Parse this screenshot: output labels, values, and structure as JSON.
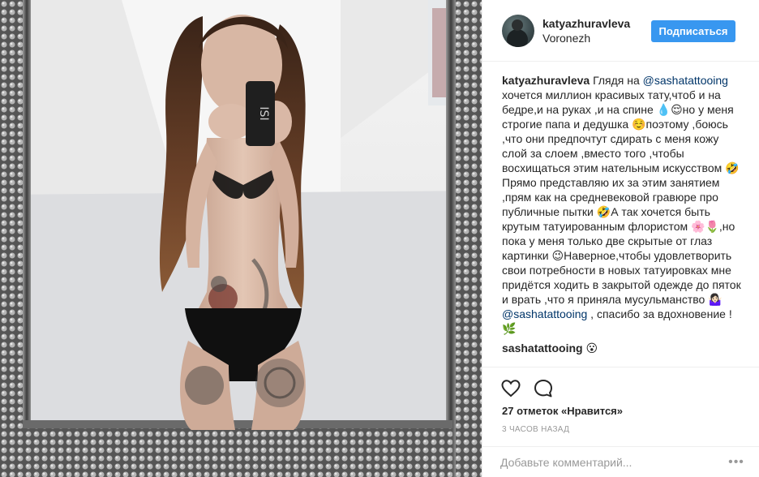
{
  "post": {
    "username": "katyazhuravleva",
    "location": "Voronezh",
    "follow_label": "Подписаться",
    "caption_parts": {
      "p1": "Глядя на ",
      "mention1": "@sashatattooing",
      "p2": " хочется миллион красивых тату,чтоб и на бедре,и на руках ,и на спине 💧😌но у меня строгие папа и дедушка ☺️поэтому ,боюсь ,что они предпочтут сдирать с меня кожу слой за слоем ,вместо того ,чтобы восхищаться этим нательным искусством 🤣 Прямо представляю их за этим занятием ,прям как на средневековой гравюре про публичные пытки 🤣А так хочется быть крутым татуированным флористом 🌸🌷,но пока у меня только две скрытые от глаз картинки 😉Наверное,чтобы удовлетворить свои потребности в новых татуировках мне придётся ходить в закрытой одежде до пяток и врать ,что я приняла мусульманство 🤷🏻‍♀️ ",
      "mention2": "@sashatattooing",
      "p3": " , спасибо за вдохновение ! 🌿"
    },
    "comment2_user": "sashatattooing",
    "comment2_text": " 😮",
    "likes": "27 отметок «Нравится»",
    "time": "3 часов назад",
    "comment_placeholder": "Добавьте комментарий...",
    "more_glyph": "•••"
  },
  "icons": {
    "heart": "heart-icon",
    "comment": "comment-icon",
    "more": "more-options-icon"
  },
  "colors": {
    "accent": "#3897f0",
    "mention": "#003569",
    "muted": "#999999",
    "frame": "#5c5c5c"
  }
}
